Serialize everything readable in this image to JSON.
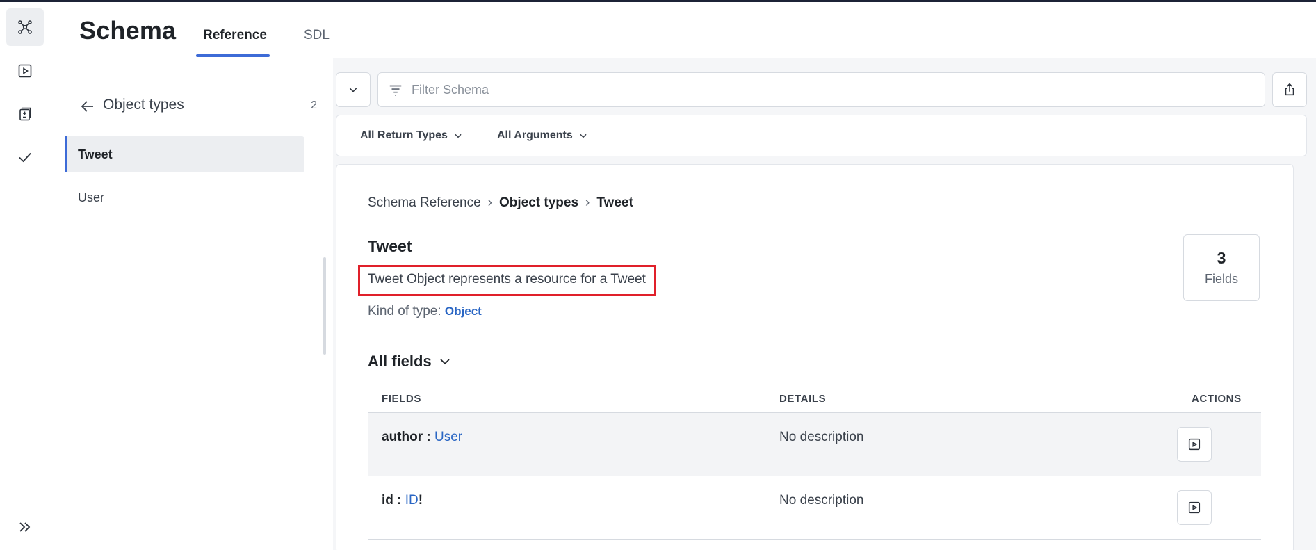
{
  "header": {
    "title": "Schema",
    "tabs": [
      {
        "label": "Reference",
        "active": true
      },
      {
        "label": "SDL",
        "active": false
      }
    ]
  },
  "rail": {
    "items": [
      {
        "icon": "schema-graph-icon",
        "active": true
      },
      {
        "icon": "play-icon",
        "active": false
      },
      {
        "icon": "changelog-icon",
        "active": false
      },
      {
        "icon": "checkmark-icon",
        "active": false
      }
    ],
    "expand_icon": "double-chevron-right-icon"
  },
  "sidebar": {
    "title": "Object types",
    "count": "2",
    "items": [
      {
        "label": "Tweet",
        "selected": true
      },
      {
        "label": "User",
        "selected": false
      }
    ]
  },
  "filter": {
    "placeholder": "Filter Schema",
    "value": ""
  },
  "toolbar": {
    "return_types_label": "All Return Types",
    "arguments_label": "All Arguments"
  },
  "breadcrumb": {
    "root": "Schema Reference",
    "section": "Object types",
    "current": "Tweet",
    "separator": "›"
  },
  "type": {
    "name": "Tweet",
    "description": "Tweet Object represents a resource for a Tweet",
    "kind_label": "Kind of type:",
    "kind_value": "Object",
    "field_count": "3",
    "field_count_label": "Fields"
  },
  "fields_section": {
    "title": "All fields",
    "columns": {
      "fields": "FIELDS",
      "details": "DETAILS",
      "actions": "ACTIONS"
    },
    "rows": [
      {
        "name": "author",
        "sep": " : ",
        "type": "User",
        "suffix": "",
        "details": "No description"
      },
      {
        "name": "id",
        "sep": " : ",
        "type": "ID",
        "suffix": "!",
        "details": "No description"
      }
    ]
  },
  "colors": {
    "accent": "#3d6bd7",
    "link": "#2a66c4",
    "highlight_box": "#e0202a"
  }
}
